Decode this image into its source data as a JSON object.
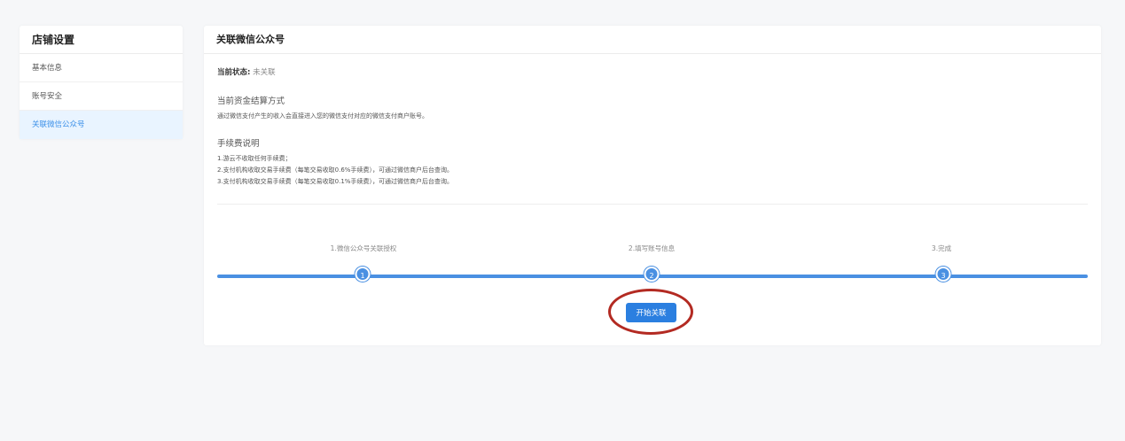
{
  "sidebar": {
    "title": "店铺设置",
    "items": [
      {
        "label": "基本信息"
      },
      {
        "label": "账号安全"
      },
      {
        "label": "关联微信公众号"
      }
    ]
  },
  "main": {
    "title": "关联微信公众号",
    "status_label": "当前状态:",
    "status_value": "未关联",
    "settlement_title": "当前资金结算方式",
    "settlement_text": "通过微信支付产生的收入会直接进入您的微信支付对应的微信支付商户账号。",
    "fee_title": "手续费说明",
    "fee_lines": [
      "1.游云不收取任何手续费；",
      "2.支付机构收取交易手续费（每笔交易收取0.6%手续费），可通过微信商户后台查询。",
      "3.支付机构收取交易手续费（每笔交易收取0.1%手续费），可通过微信商户后台查询。"
    ],
    "steps": [
      {
        "number": "1",
        "label": "1.微信公众号关联授权"
      },
      {
        "number": "2",
        "label": "2.填写账号信息"
      },
      {
        "number": "3",
        "label": "3.完成"
      }
    ],
    "start_button": "开始关联"
  },
  "colors": {
    "accent": "#2b7fe0",
    "active_bg": "#e9f4ff",
    "highlight_ring": "#b32a22"
  }
}
